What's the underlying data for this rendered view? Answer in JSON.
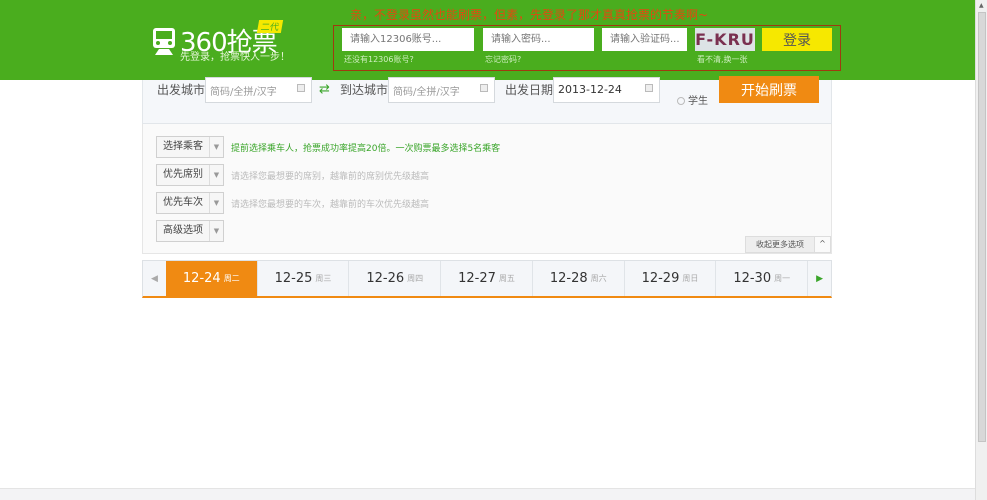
{
  "header": {
    "logo_name": "360抢票",
    "logo_badge": "二代",
    "slogan": "先登录，抢票快人一步！",
    "tip": "亲，不登录虽然也能刷票，但素，先登录了那才真真抢票的节奏啊~",
    "login": {
      "account_placeholder": "请输入12306账号...",
      "password_placeholder": "请输入密码...",
      "captcha_placeholder": "请输入验证码...",
      "no_account_link": "还没有12306账号?",
      "forgot_link": "忘记密码?",
      "captcha_text": "F-KRU",
      "refresh_captcha": "看不清,换一张",
      "login_button": "登录"
    }
  },
  "search": {
    "from_label": "出发城市",
    "from_placeholder": "简码/全拼/汉字",
    "to_label": "到达城市",
    "to_placeholder": "简码/全拼/汉字",
    "date_label": "出发日期",
    "date_value": "2013-12-24",
    "student_label": "学生",
    "start_button": "开始刷票"
  },
  "options": [
    {
      "label": "选择乘客",
      "hint": "提前选择乘车人，抢票成功率提高20倍。一次购票最多选择5名乘客"
    },
    {
      "label": "优先席别",
      "hint": "请选择您最想要的席别，越靠前的席别优先级越高"
    },
    {
      "label": "优先车次",
      "hint": "请选择您最想要的车次，越靠前的车次优先级越高"
    },
    {
      "label": "高级选项",
      "hint": ""
    }
  ],
  "collapse_label": "收起更多选项",
  "dates": [
    {
      "date": "12-24",
      "weekday": "周二",
      "active": true
    },
    {
      "date": "12-25",
      "weekday": "周三"
    },
    {
      "date": "12-26",
      "weekday": "周四"
    },
    {
      "date": "12-27",
      "weekday": "周五"
    },
    {
      "date": "12-28",
      "weekday": "周六"
    },
    {
      "date": "12-29",
      "weekday": "周日"
    },
    {
      "date": "12-30",
      "weekday": "周一"
    }
  ],
  "colors": {
    "header": "#4aad1e",
    "accent": "#f08a12",
    "login_button": "#f6e800"
  }
}
